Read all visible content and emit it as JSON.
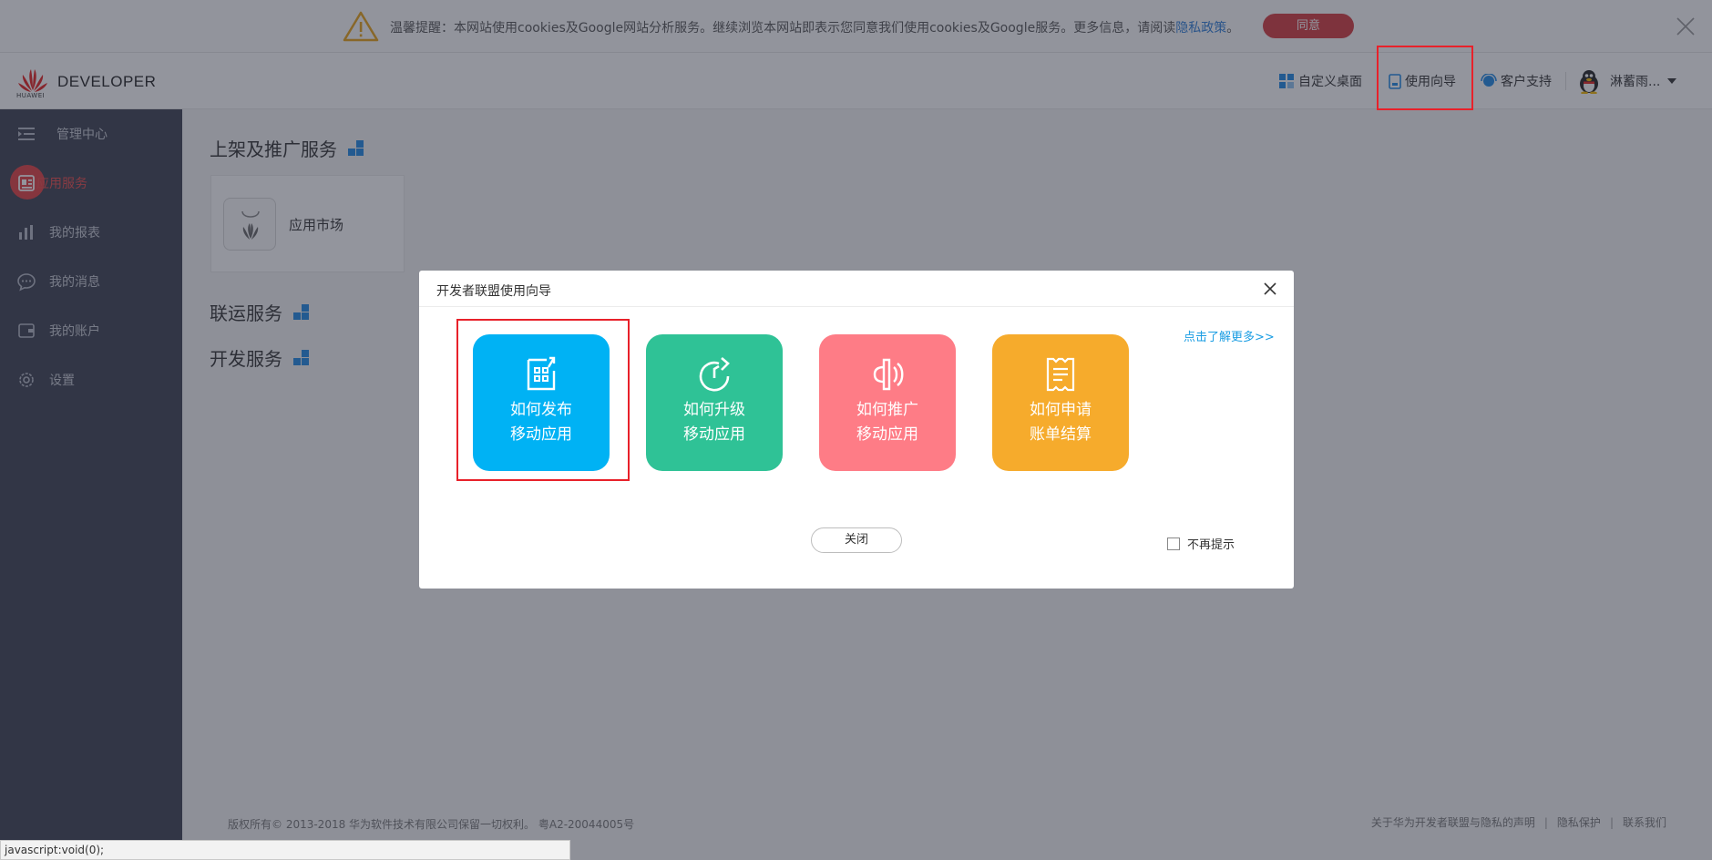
{
  "cookie_bar": {
    "text": "温馨提醒：本网站使用cookies及Google网站分析服务。继续浏览本网站即表示您同意我们使用cookies及Google服务。更多信息，请阅读",
    "policy_link": "隐私政策",
    "text_end": "。",
    "agree_label": "同意"
  },
  "header": {
    "logo_brand": "HUAWEI",
    "logo_text": "DEVELOPER",
    "nav": {
      "custom_desktop": "自定义桌面",
      "user_guide": "使用向导",
      "support": "客户支持",
      "user_name": "淋蓄雨..."
    }
  },
  "sidebar": {
    "items": [
      {
        "label": "管理中心",
        "icon": "menu-icon"
      },
      {
        "label": "应用服务",
        "icon": "app-service-icon",
        "active": true
      },
      {
        "label": "我的报表",
        "icon": "bar-chart-icon"
      },
      {
        "label": "我的消息",
        "icon": "message-icon"
      },
      {
        "label": "我的账户",
        "icon": "account-icon"
      },
      {
        "label": "设置",
        "icon": "gear-icon"
      }
    ]
  },
  "main": {
    "sections": [
      {
        "title": "上架及推广服务"
      },
      {
        "title": "联运服务"
      },
      {
        "title": "开发服务"
      }
    ],
    "app_card_label": "应用市场"
  },
  "footer": {
    "copyright": "版权所有© 2013-2018 华为软件技术有限公司保留一切权利。 粤A2-20044005号",
    "links": [
      "关于华为开发者联盟与隐私的声明",
      "隐私保护",
      "联系我们"
    ]
  },
  "statusbar": {
    "text": "javascript:void(0);"
  },
  "modal": {
    "title": "开发者联盟使用向导",
    "learn_more": "点击了解更多>>",
    "tiles": [
      {
        "line1": "如何发布",
        "line2": "移动应用",
        "color": "#00b2f4"
      },
      {
        "line1": "如何升级",
        "line2": "移动应用",
        "color": "#2fc296"
      },
      {
        "line1": "如何推广",
        "line2": "移动应用",
        "color": "#fe7c86"
      },
      {
        "line1": "如何申请",
        "line2": "账单结算",
        "color": "#f6ab2c"
      }
    ],
    "close_label": "关闭",
    "no_remind_label": "不再提示",
    "no_remind_checked": false
  }
}
